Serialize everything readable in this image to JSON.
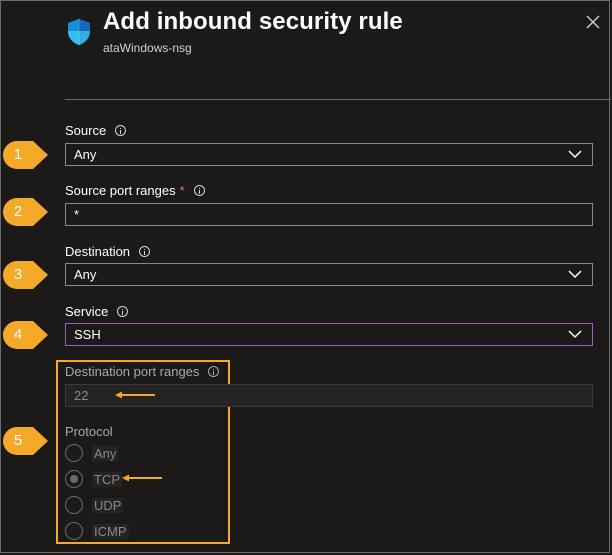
{
  "header": {
    "title": "Add inbound security rule",
    "subtitle": "ataWindows-nsg"
  },
  "fields": {
    "source": {
      "label": "Source",
      "value": "Any"
    },
    "source_port_ranges": {
      "label": "Source port ranges",
      "required_marker": "*",
      "value": "*"
    },
    "destination": {
      "label": "Destination",
      "value": "Any"
    },
    "service": {
      "label": "Service",
      "value": "SSH"
    },
    "destination_port_ranges": {
      "label": "Destination port ranges",
      "value": "22"
    },
    "protocol": {
      "label": "Protocol",
      "options": [
        "Any",
        "TCP",
        "UDP",
        "ICMP"
      ],
      "selected": "TCP"
    }
  },
  "badges": [
    "1",
    "2",
    "3",
    "4",
    "5"
  ],
  "colors": {
    "background": "#1b1a19",
    "badge": "#f4a928",
    "highlight": "#f4a928",
    "service_border": "#a05dbb",
    "required": "#f1707b"
  },
  "icons": {
    "header": "shield-icon",
    "close": "close-icon",
    "dropdown": "chevron-down-icon",
    "info": "info-icon",
    "annotation_arrow": "arrow-left-icon"
  }
}
